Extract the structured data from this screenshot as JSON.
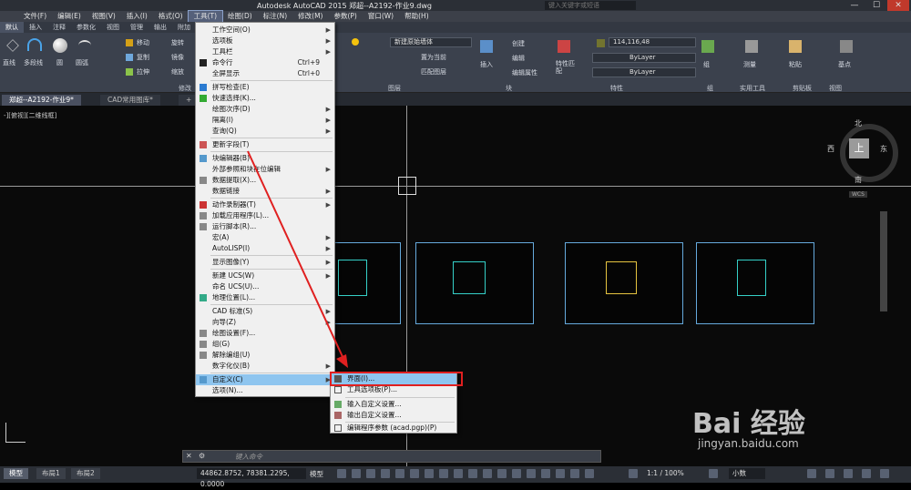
{
  "app": {
    "title": "Autodesk AutoCAD 2015    郑超--A2192-作业9.dwg",
    "search_placeholder": "键入关键字或短语",
    "win_minimize": "—",
    "win_maximize": "☐",
    "win_close": "✕"
  },
  "menubar": [
    "文件(F)",
    "编辑(E)",
    "视图(V)",
    "插入(I)",
    "格式(O)",
    "工具(T)",
    "绘图(D)",
    "标注(N)",
    "修改(M)",
    "参数(P)",
    "窗口(W)",
    "帮助(H)"
  ],
  "ribbon_tabs": [
    "默认",
    "插入",
    "注释",
    "参数化",
    "视图",
    "管理",
    "输出",
    "附加"
  ],
  "ribbon": {
    "draw": [
      "直线",
      "多段线",
      "圆",
      "圆弧"
    ],
    "modify": [
      "移动",
      "旋转",
      "复制",
      "镜像",
      "拉伸",
      "缩放"
    ],
    "layer_dropdown": "新建原始墙体",
    "layer_btns": [
      "置为当前",
      "匹配图层"
    ],
    "block": [
      "插入",
      "创建",
      "编辑",
      "编辑属性"
    ],
    "properties": {
      "match": "特性匹配",
      "color": "114,116,48",
      "linetype": "ByLayer",
      "lineweight": "ByLayer"
    },
    "group": "组",
    "utilities": "测量",
    "clipboard": "粘贴",
    "base": "基点"
  },
  "panel_labels": [
    "修改",
    "图层",
    "块",
    "特性",
    "组",
    "实用工具",
    "剪贴板",
    "视图"
  ],
  "doc_tabs": [
    "郑超--A2192-作业9*",
    "CAD常用图库*",
    "+"
  ],
  "viewport_label": "-][俯视][二维线框]",
  "viewcube": {
    "north": "北",
    "south": "南",
    "east": "东",
    "west": "西",
    "top": "上",
    "wcs": "WCS"
  },
  "tools_menu": {
    "items": [
      {
        "label": "工作空间(O)",
        "arrow": true
      },
      {
        "label": "选项板",
        "arrow": true
      },
      {
        "label": "工具栏",
        "arrow": true
      },
      {
        "label": "命令行",
        "shortcut": "Ctrl+9"
      },
      {
        "label": "全屏显示",
        "shortcut": "Ctrl+0"
      },
      {
        "label": "拼写检查(E)"
      },
      {
        "label": "快速选择(K)..."
      },
      {
        "label": "绘图次序(D)",
        "arrow": true
      },
      {
        "label": "隔离(I)",
        "arrow": true
      },
      {
        "label": "查询(Q)",
        "arrow": true
      },
      {
        "label": "更新字段(T)"
      },
      {
        "label": "块编辑器(B)"
      },
      {
        "label": "外部参照和块在位编辑",
        "arrow": true
      },
      {
        "label": "数据提取(X)..."
      },
      {
        "label": "数据链接",
        "arrow": true
      },
      {
        "label": "动作录制器(T)",
        "arrow": true
      },
      {
        "label": "加载应用程序(L)..."
      },
      {
        "label": "运行脚本(R)..."
      },
      {
        "label": "宏(A)",
        "arrow": true
      },
      {
        "label": "AutoLISP(I)",
        "arrow": true
      },
      {
        "label": "显示图像(Y)",
        "arrow": true
      },
      {
        "label": "新建 UCS(W)",
        "arrow": true
      },
      {
        "label": "命名 UCS(U)..."
      },
      {
        "label": "地理位置(L)..."
      },
      {
        "label": "CAD 标准(S)",
        "arrow": true
      },
      {
        "label": "向导(Z)",
        "arrow": true
      },
      {
        "label": "绘图设置(F)..."
      },
      {
        "label": "组(G)"
      },
      {
        "label": "解除编组(U)"
      },
      {
        "label": "数字化仪(B)",
        "arrow": true
      },
      {
        "label": "自定义(C)",
        "arrow": true
      },
      {
        "label": "选项(N)..."
      }
    ]
  },
  "customize_submenu": [
    "界面(I)...",
    "工具选项板(P)...",
    "输入自定义设置...",
    "输出自定义设置...",
    "编辑程序参数 (acad.pgp)(P)"
  ],
  "command_line": {
    "placeholder": "键入命令"
  },
  "layout_tabs": [
    "模型",
    "布局1",
    "布局2"
  ],
  "status": {
    "coords": "44862.8752, 78381.2295, 0.0000",
    "model": "模型",
    "scale": "1:1 / 100%",
    "units": "小数"
  },
  "watermark": {
    "brand": "Bai 经验",
    "url": "jingyan.baidu.com"
  },
  "colors": {
    "accent_highlight": "#8ec5ef",
    "annotation_red": "#e02020",
    "menu_bg": "#f0f0f0"
  }
}
